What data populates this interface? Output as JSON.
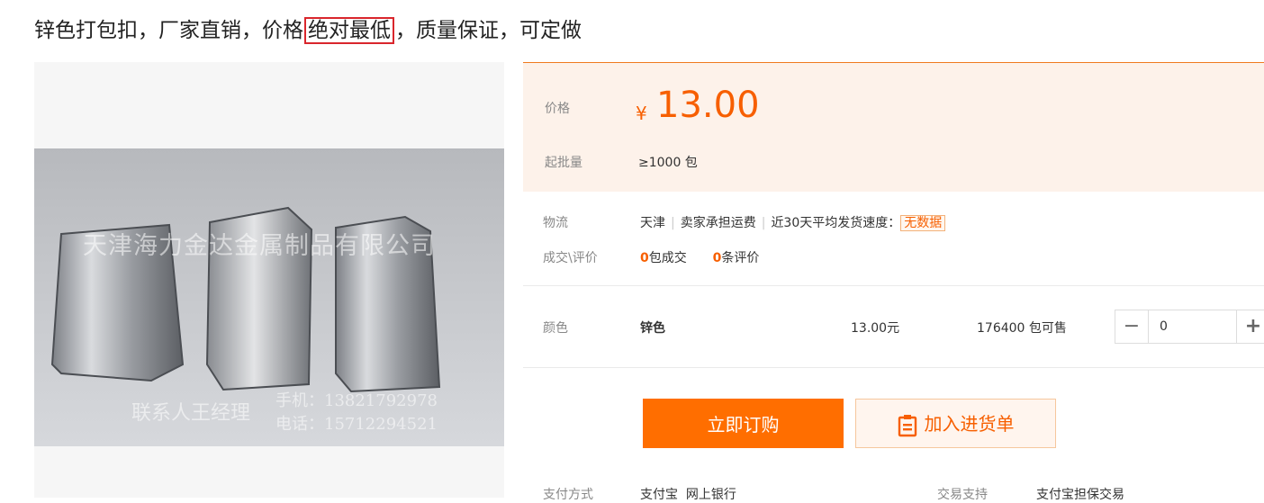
{
  "title": {
    "before": "锌色打包扣，厂家直销，价格",
    "highlight": "绝对最低",
    "after": "，质量保证，可定做"
  },
  "image": {
    "watermark_company": "天津海力金达金属制品有限公司",
    "watermark_contact": "联系人王经理",
    "watermark_mobile": "手机：13821792978",
    "watermark_phone": "电话：15712294521"
  },
  "price": {
    "label": "价格",
    "currency": "¥",
    "value": "13.00",
    "moq_label": "起批量",
    "moq_value": "≥1000 包"
  },
  "logistics": {
    "label": "物流",
    "origin": "天津",
    "shipping": "卖家承担运费",
    "speed_label": "近30天平均发货速度：",
    "speed_value": "无数据"
  },
  "trade": {
    "label": "成交\\评价",
    "orders_count": "0",
    "orders_unit": "包成交",
    "reviews_count": "0",
    "reviews_unit": "条评价"
  },
  "sku": {
    "label": "颜色",
    "name": "锌色",
    "price": "13.00元",
    "stock": "176400 包可售",
    "minus": "−",
    "quantity": "0",
    "plus": "+"
  },
  "actions": {
    "buy_label": "立即订购",
    "cart_label": "加入进货单"
  },
  "footer": {
    "payment_label": "支付方式",
    "payment_value": "支付宝  网上银行",
    "support_label": "交易支持",
    "support_value": "支付宝担保交易"
  },
  "colors": {
    "accent": "#ff6e00",
    "price_bg": "#fdf2ea",
    "highlight_border": "#d9262c"
  }
}
